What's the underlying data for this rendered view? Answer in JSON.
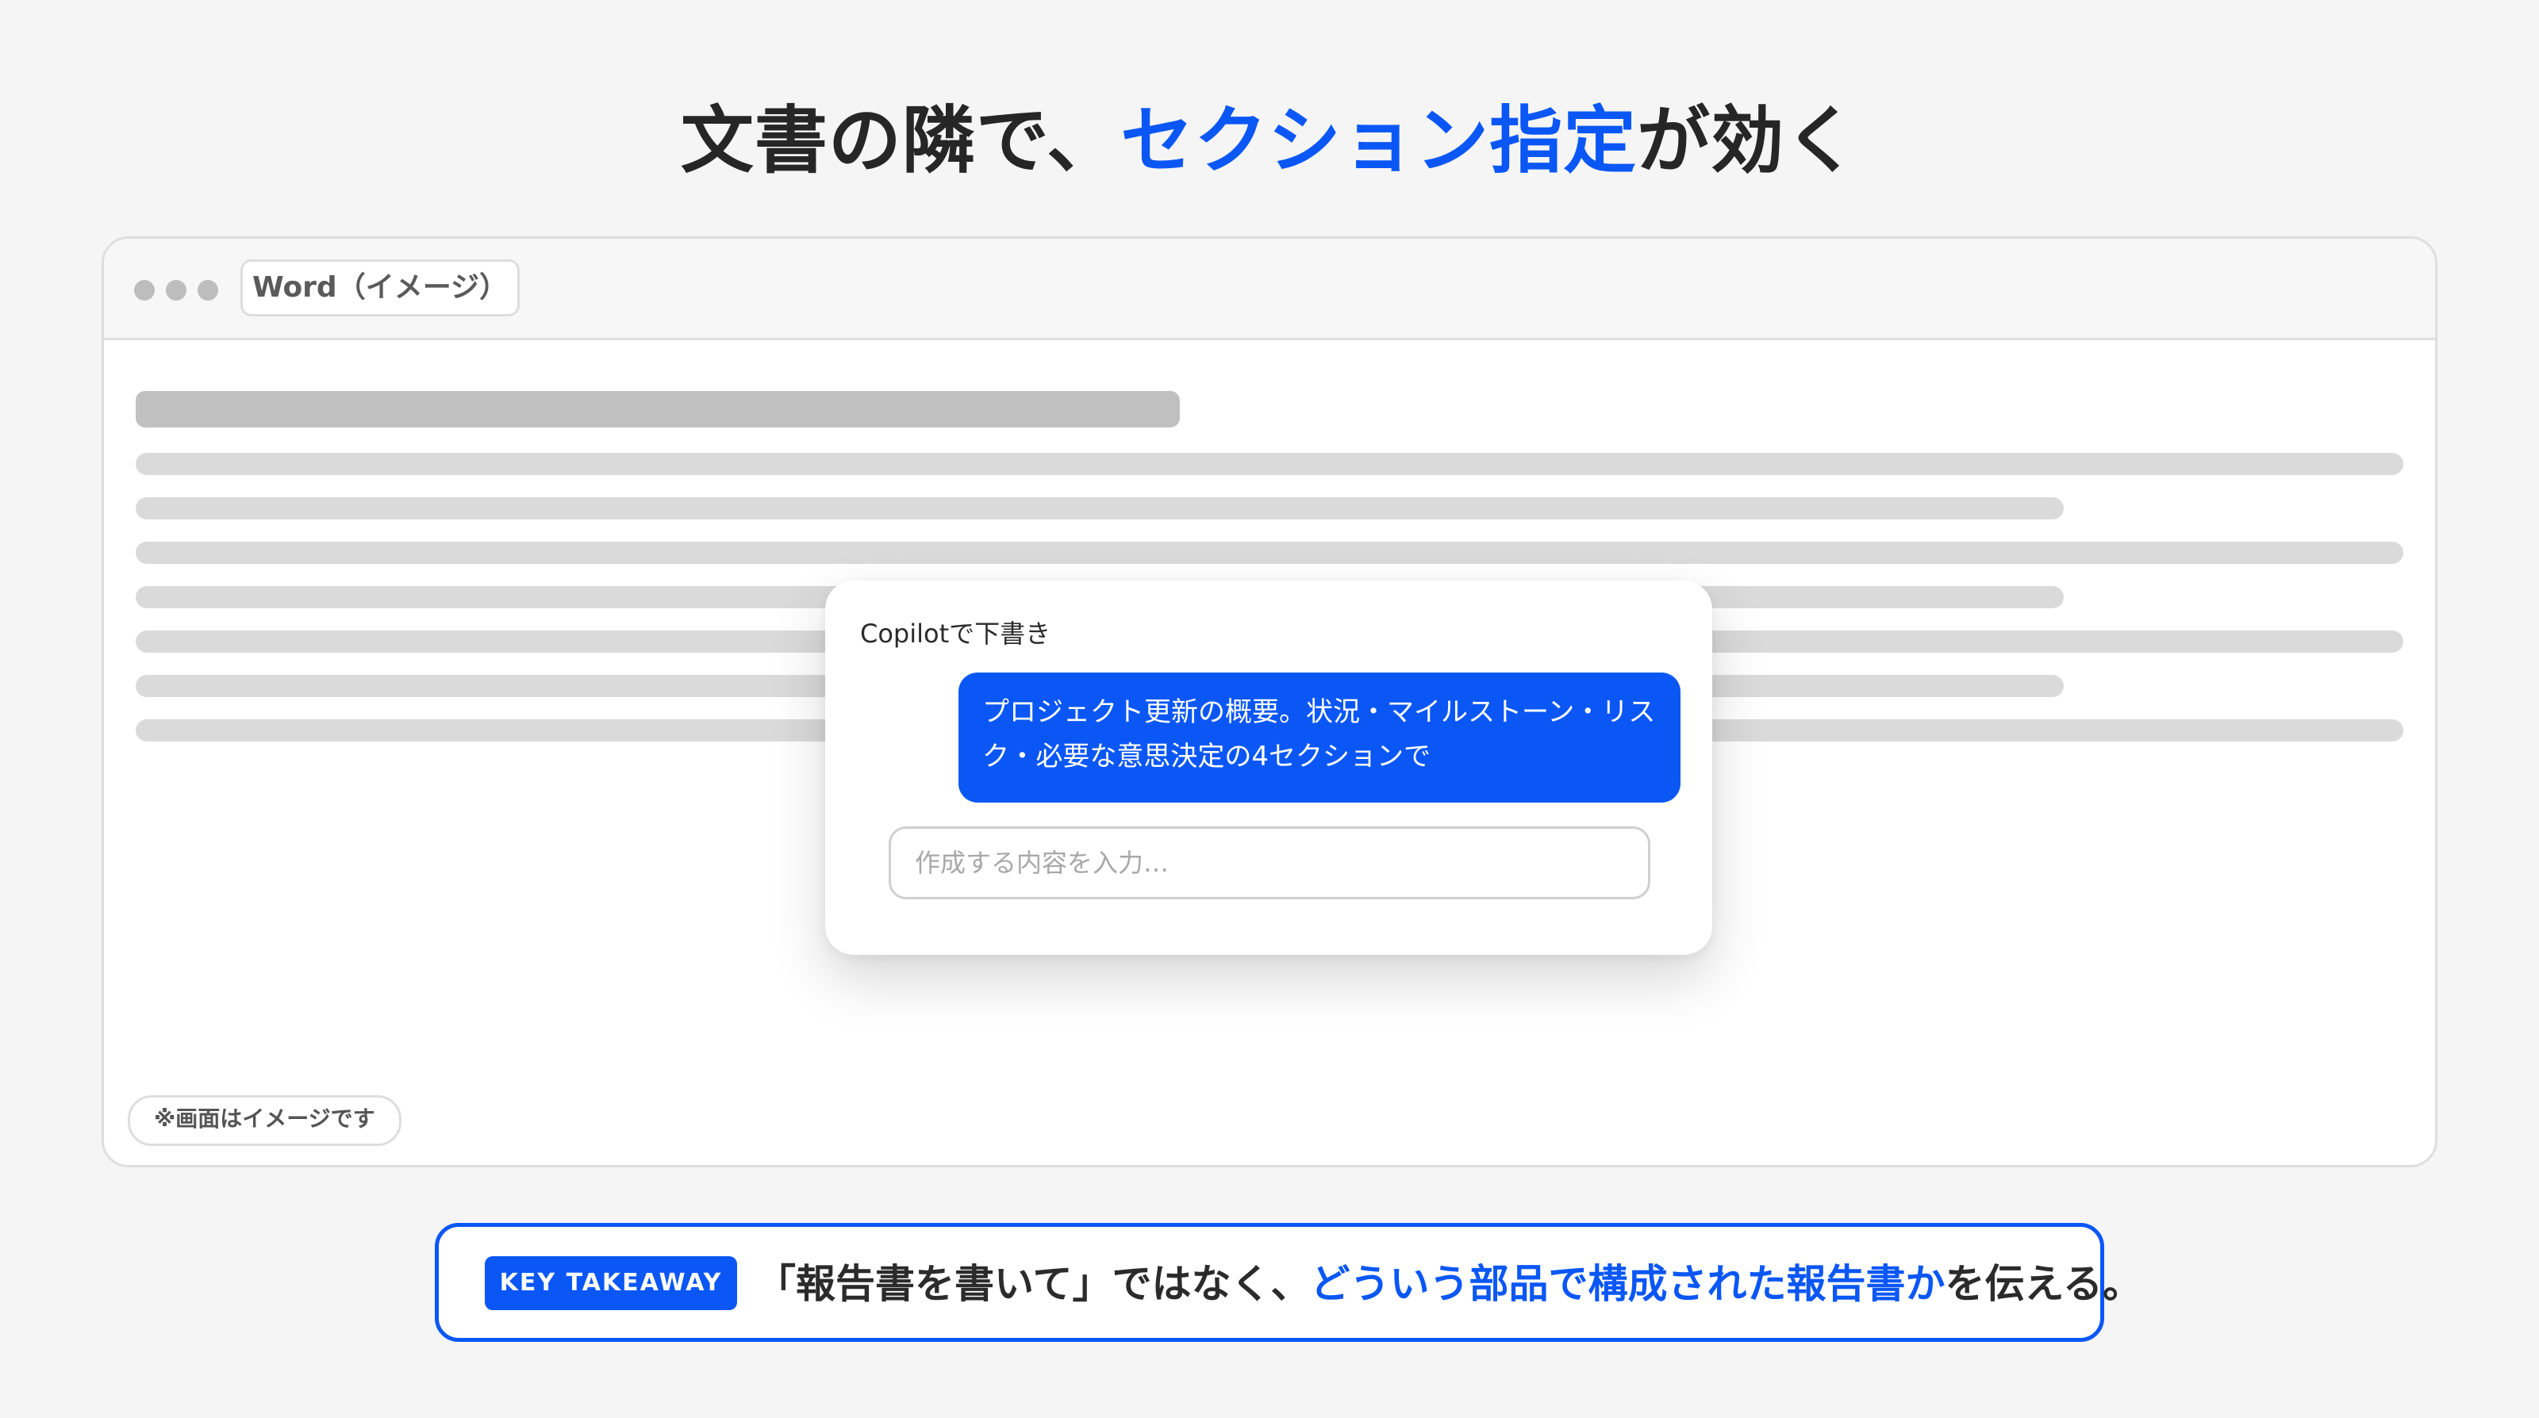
{
  "headline": {
    "part1": "文書の隣で、",
    "part2": "セクション指定",
    "part3": "が効く"
  },
  "window": {
    "tab_label": "Word（イメージ）",
    "note": "※画面はイメージです"
  },
  "copilot": {
    "title": "Copilotで下書き",
    "prompt": "プロジェクト更新の概要。状況・マイルストーン・リスク・必要な意思決定の4セクションで",
    "input_placeholder": "作成する内容を入力…"
  },
  "takeaway": {
    "badge": "KEY TAKEAWAY",
    "text1": "「報告書を書いて」ではなく、",
    "text2": "どういう部品で構成された報告書か",
    "text3": "を伝える。"
  },
  "colors": {
    "accent": "#0b57f5",
    "background": "#f5f5f5",
    "skeleton": "#dadada"
  },
  "icons": [
    "window-dot",
    "window-dot",
    "window-dot"
  ]
}
